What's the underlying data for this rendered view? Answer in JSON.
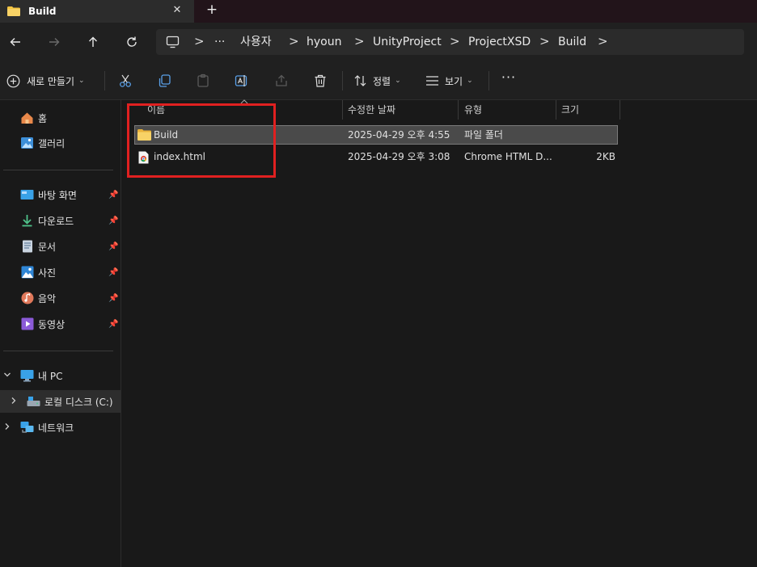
{
  "window": {
    "tab_title": "Build",
    "close_glyph": "✕",
    "new_tab_glyph": "+"
  },
  "nav": {
    "icons": [
      "back-arrow-icon",
      "forward-arrow-icon",
      "up-arrow-icon",
      "refresh-icon"
    ],
    "breadcrumb": {
      "overflow": "···",
      "items": [
        "사용자",
        "hyoun",
        "UnityProject",
        "ProjectXSD",
        "Build"
      ],
      "separator": ">"
    }
  },
  "toolbar": {
    "new_label": "새로 만들기",
    "sort_label": "정렬",
    "view_label": "보기",
    "more_glyph": "···",
    "chevron": "⌄"
  },
  "sidebar": {
    "pin_glyph": "📌",
    "quick": [
      {
        "label": "홈",
        "icon": "home-icon"
      },
      {
        "label": "갤러리",
        "icon": "gallery-icon"
      }
    ],
    "pinned": [
      {
        "label": "바탕 화면",
        "icon": "desktop-icon"
      },
      {
        "label": "다운로드",
        "icon": "download-icon"
      },
      {
        "label": "문서",
        "icon": "documents-icon"
      },
      {
        "label": "사진",
        "icon": "pictures-icon"
      },
      {
        "label": "음악",
        "icon": "music-icon"
      },
      {
        "label": "동영상",
        "icon": "videos-icon"
      }
    ],
    "this_pc": "내 PC",
    "local_disk": "로컬 디스크 (C:)",
    "network": "네트워크"
  },
  "file_list": {
    "columns": [
      "이름",
      "수정한 날짜",
      "유형",
      "크기"
    ],
    "rows": [
      {
        "name": "Build",
        "modified": "2025-04-29 오후 4:55",
        "type": "파일 폴더",
        "size": "",
        "icon": "folder-icon",
        "selected": true
      },
      {
        "name": "index.html",
        "modified": "2025-04-29 오후 3:08",
        "type": "Chrome HTML D...",
        "size": "2KB",
        "icon": "chrome-html-icon",
        "selected": false
      }
    ]
  },
  "colors": {
    "highlight_box": "#e02020",
    "folder": "#f4c542",
    "background": "#191919"
  }
}
